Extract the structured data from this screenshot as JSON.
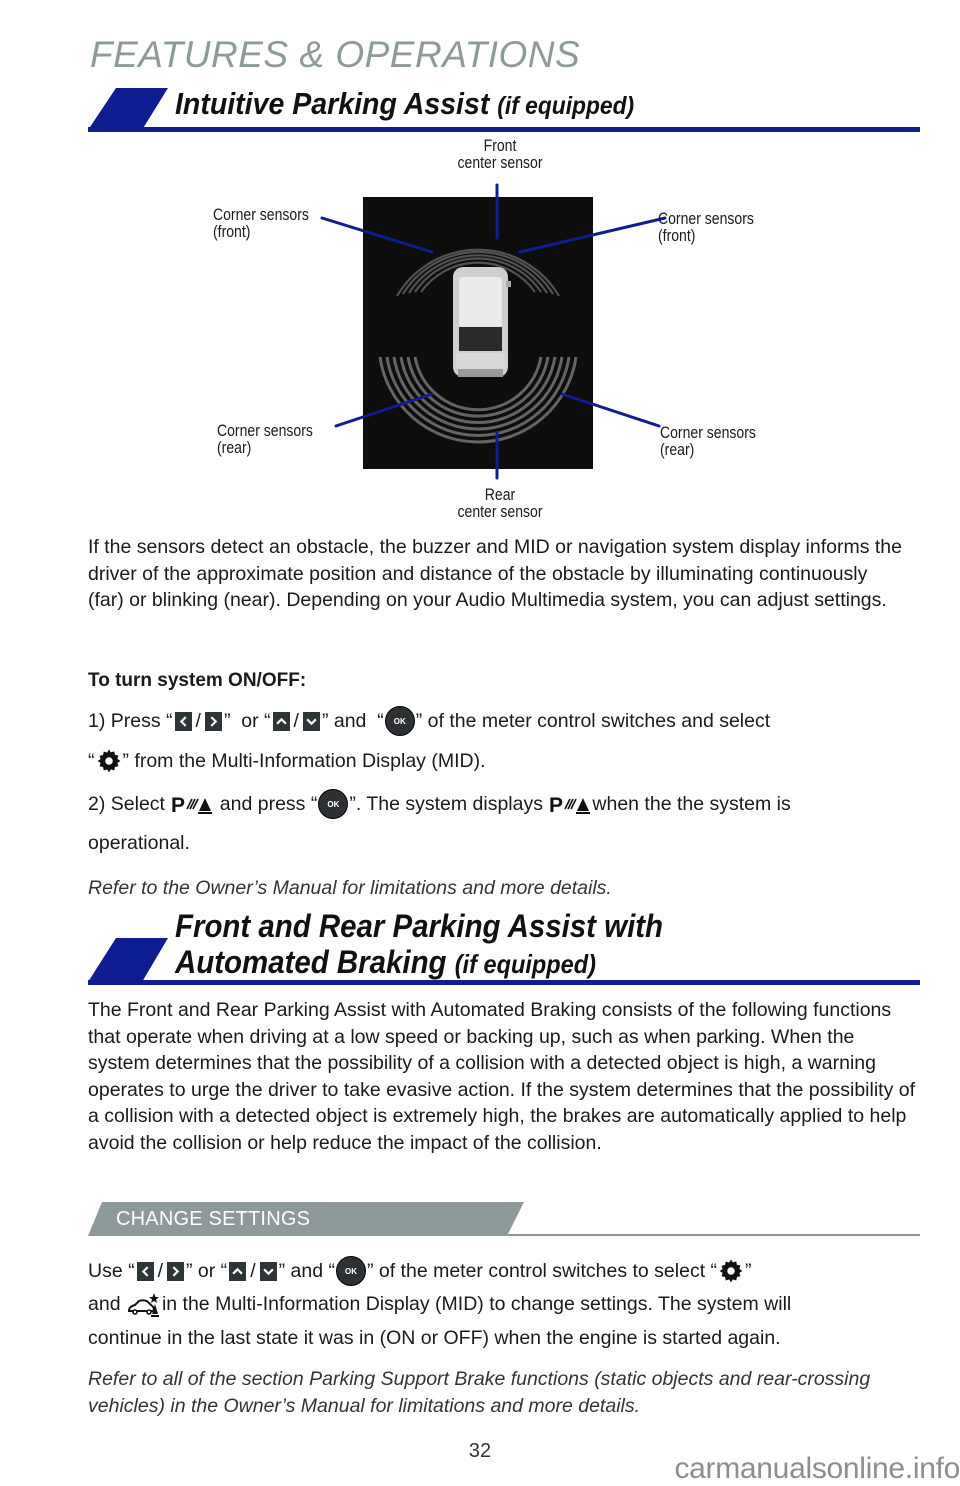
{
  "page": {
    "header": "FEATURES & OPERATIONS",
    "number": "32",
    "watermark": "carmanualsonline.info"
  },
  "colors": {
    "brand_blue": "#0e1d8f",
    "header_gray": "#8c9a98",
    "subbanner_gray": "#8d9a99"
  },
  "section1": {
    "title": "Intuitive Parking Assist",
    "suffix": "(if equipped)",
    "diagram": {
      "front_center": [
        "Front",
        "center sensor"
      ],
      "corner_front_left": [
        "Corner sensors",
        "(front)"
      ],
      "corner_front_right": [
        "Corner sensors",
        "(front)"
      ],
      "corner_rear_left": [
        "Corner sensors",
        "(rear)"
      ],
      "corner_rear_right": [
        "Corner sensors",
        "(rear)"
      ],
      "rear_center": [
        "Rear",
        "center sensor"
      ]
    },
    "intro": "If the sensors detect an obstacle, the buzzer and MID or navigation system display informs the driver of the approximate position and distance of the obstacle by illuminating continuously (far) or blinking (near). Depending on your Audio Multimedia system, you can adjust settings.",
    "onoff_heading": "To turn system ON/OFF:",
    "step1": {
      "a": "1) Press “",
      "b": "/",
      "c": "”  or “",
      "d": "/",
      "e": "” and  “",
      "f": "” of the meter control switches and select",
      "g": "“",
      "h": "” from the Multi-Information Display (MID)."
    },
    "step2": {
      "a": "2) Select ",
      "b": " and press “",
      "c": "”. The system displays ",
      "d": " when the the system is",
      "e": "operational."
    },
    "note": "Refer to the Owner’s Manual for limitations and more details."
  },
  "section2": {
    "title_line1": "Front and Rear Parking Assist with",
    "title_line2": "Automated Braking",
    "suffix": "(if equipped)",
    "body": "The Front and Rear Parking Assist with Automated Braking consists of the following functions that operate when driving at a low speed or backing up, such as when parking. When the system determines that the possibility of a collision with a detected object is high, a warning operates to urge the driver to take evasive action. If the system determines that the possibility of a collision with a detected object is extremely high, the brakes are automatically applied to help avoid the collision or help reduce the impact of the collision.",
    "change_settings": {
      "label": "CHANGE SETTINGS",
      "line1": {
        "a": "Use “",
        "b": "/",
        "c": "” or “",
        "d": "/",
        "e": "” and “",
        "f": "” of the meter control switches to select “",
        "g": "”"
      },
      "line2": {
        "a": "and ",
        "b": " in the Multi-Information Display (MID) to change settings. The system will"
      },
      "line3": "continue in the last state it was in (ON or OFF) when the engine is started again.",
      "note": "Refer to all of the section Parking Support Brake functions (static objects and rear-crossing vehicles) in the Owner’s Manual for limitations and more details."
    }
  },
  "icons": {
    "ok_label": "OK"
  }
}
